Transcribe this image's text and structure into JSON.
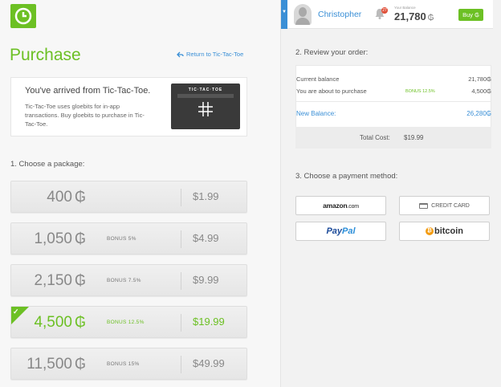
{
  "header": {
    "username": "Christopher",
    "notification_count": "27",
    "balance_label": "Your Balance",
    "balance_value": "21,780",
    "buy_label": "Buy"
  },
  "currency_symbol": "₲",
  "page": {
    "title": "Purchase",
    "return_link": "Return to Tic-Tac-Toe"
  },
  "arrived": {
    "title": "You've arrived from Tic-Tac-Toe.",
    "description": "Tic-Tac-Toe uses gloebits for in-app transactions. Buy gloebits to purchase in Tic-Tac-Toe.",
    "thumb_title": "TIC·TAC·TOE"
  },
  "package_section": {
    "label": "1. Choose a package:",
    "packages": [
      {
        "amount": "400",
        "bonus": "",
        "price": "$1.99",
        "selected": false
      },
      {
        "amount": "1,050",
        "bonus": "BONUS 5%",
        "price": "$4.99",
        "selected": false
      },
      {
        "amount": "2,150",
        "bonus": "BONUS 7.5%",
        "price": "$9.99",
        "selected": false
      },
      {
        "amount": "4,500",
        "bonus": "BONUS 12.5%",
        "price": "$19.99",
        "selected": true
      },
      {
        "amount": "11,500",
        "bonus": "BONUS 15%",
        "price": "$49.99",
        "selected": false
      }
    ]
  },
  "review": {
    "title": "2. Review your order:",
    "current_balance_label": "Current balance",
    "current_balance_value": "21,780",
    "purchase_label": "You are about to purchase",
    "purchase_bonus": "BONUS 12.5%",
    "purchase_value": "4,500",
    "new_balance_label": "New Balance:",
    "new_balance_value": "26,280",
    "total_label": "Total Cost:",
    "total_value": "$19.99"
  },
  "payment": {
    "title": "3. Choose a payment method:",
    "amazon_main": "amazon",
    "amazon_suffix": ".com",
    "credit_card": "CREDIT CARD",
    "paypal_a": "Pay",
    "paypal_b": "Pal",
    "bitcoin": "bitcoin"
  },
  "colors": {
    "accent_green": "#6cc024",
    "link_blue": "#3a8fd6"
  }
}
